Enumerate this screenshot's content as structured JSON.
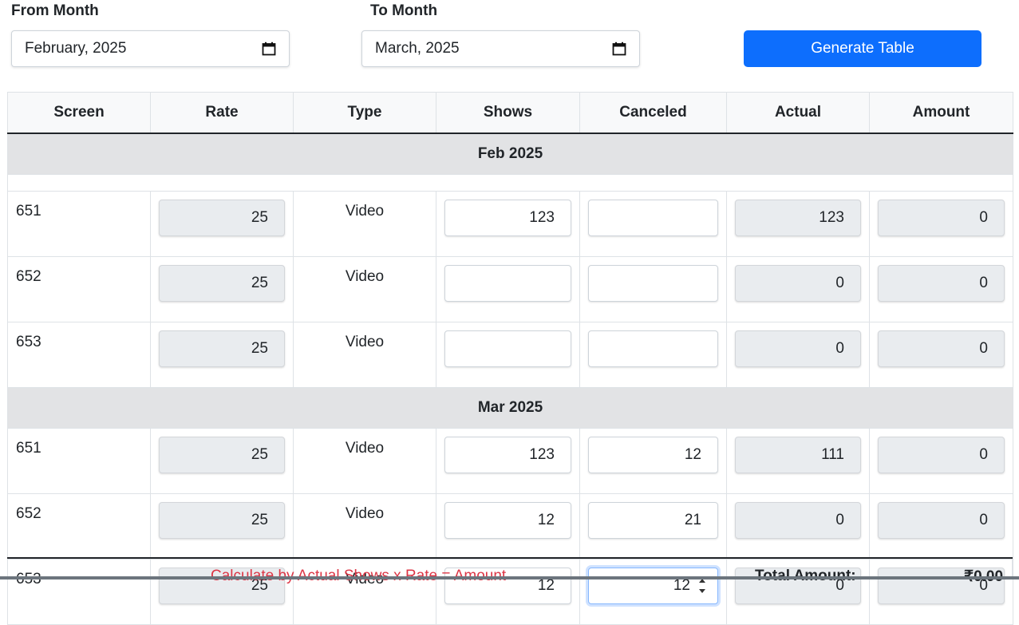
{
  "filters": {
    "from_label": "From Month",
    "from_value": "February, 2025",
    "to_label": "To Month",
    "to_value": "March, 2025",
    "generate_label": "Generate Table"
  },
  "table": {
    "headers": [
      "Screen",
      "Rate",
      "Type",
      "Shows",
      "Canceled",
      "Actual",
      "Amount"
    ],
    "groups": [
      {
        "month": "Feb 2025",
        "rows": [
          {
            "screen": "651",
            "rate": "25",
            "type": "Video",
            "shows": "123",
            "canceled": "",
            "actual": "123",
            "amount": "0"
          },
          {
            "screen": "652",
            "rate": "25",
            "type": "Video",
            "shows": "",
            "canceled": "",
            "actual": "0",
            "amount": "0"
          },
          {
            "screen": "653",
            "rate": "25",
            "type": "Video",
            "shows": "",
            "canceled": "",
            "actual": "0",
            "amount": "0"
          }
        ]
      },
      {
        "month": "Mar 2025",
        "rows": [
          {
            "screen": "651",
            "rate": "25",
            "type": "Video",
            "shows": "123",
            "canceled": "12",
            "actual": "111",
            "amount": "0"
          },
          {
            "screen": "652",
            "rate": "25",
            "type": "Video",
            "shows": "12",
            "canceled": "21",
            "actual": "0",
            "amount": "0"
          },
          {
            "screen": "653",
            "rate": "25",
            "type": "Video",
            "shows": "12",
            "canceled": "12",
            "actual": "0",
            "amount": "0"
          }
        ]
      }
    ]
  },
  "footer": {
    "note": "Calculate by Actual Shows x Rate = Amount",
    "total_label": "Total Amount:",
    "total_value": "₹0.00"
  },
  "icons": {
    "calendar": "calendar-icon",
    "spinner": "number-spinner-icon"
  },
  "colors": {
    "primary": "#0d6efd",
    "note": "#dc3545",
    "group_bg": "#e2e3e5"
  }
}
